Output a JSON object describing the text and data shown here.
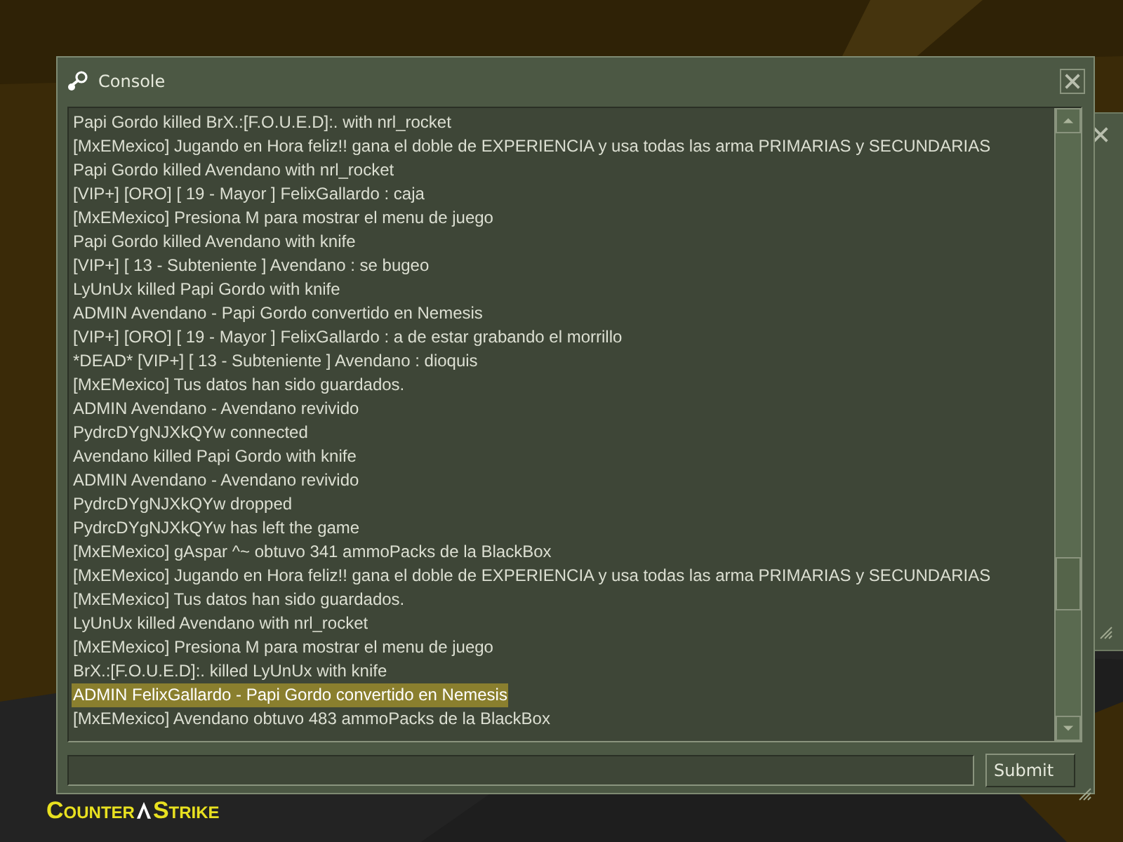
{
  "logo": {
    "left": "Counter",
    "right": "Strike"
  },
  "window": {
    "title": "Console"
  },
  "log": [
    {
      "text": "Papi Gordo killed BrX.:[F.O.U.E.D]:. with nrl_rocket",
      "selected": false
    },
    {
      "text": "[MxEMexico] Jugando en Hora feliz!! gana el doble de EXPERIENCIA y usa todas las arma PRIMARIAS y SECUNDARIAS",
      "selected": false
    },
    {
      "text": "Papi Gordo killed Avendano with nrl_rocket",
      "selected": false
    },
    {
      "text": "[VIP+] [ORO] [ 19 - Mayor ] FelixGallardo : caja",
      "selected": false
    },
    {
      "text": "[MxEMexico] Presiona M para mostrar el menu de juego",
      "selected": false
    },
    {
      "text": "Papi Gordo killed Avendano with knife",
      "selected": false
    },
    {
      "text": "[VIP+] [ 13 - Subteniente ] Avendano : se bugeo",
      "selected": false
    },
    {
      "text": "LyUnUx killed Papi Gordo with knife",
      "selected": false
    },
    {
      "text": "ADMIN Avendano - Papi Gordo convertido en Nemesis",
      "selected": false
    },
    {
      "text": "[VIP+] [ORO] [ 19 - Mayor ] FelixGallardo : a de estar grabando el morrillo",
      "selected": false
    },
    {
      "text": "*DEAD* [VIP+] [ 13 - Subteniente ] Avendano : dioquis",
      "selected": false
    },
    {
      "text": "[MxEMexico] Tus datos han sido guardados.",
      "selected": false
    },
    {
      "text": "ADMIN Avendano - Avendano revivido",
      "selected": false
    },
    {
      "text": "PydrcDYgNJXkQYw connected",
      "selected": false
    },
    {
      "text": "Avendano killed Papi Gordo with knife",
      "selected": false
    },
    {
      "text": "ADMIN Avendano - Avendano revivido",
      "selected": false
    },
    {
      "text": "PydrcDYgNJXkQYw dropped",
      "selected": false
    },
    {
      "text": "PydrcDYgNJXkQYw has left the game",
      "selected": false
    },
    {
      "text": "[MxEMexico] gAspar ^~ obtuvo 341 ammoPacks de la BlackBox",
      "selected": false
    },
    {
      "text": "[MxEMexico] Jugando en Hora feliz!! gana el doble de EXPERIENCIA y usa todas las arma PRIMARIAS y SECUNDARIAS",
      "selected": false
    },
    {
      "text": "[MxEMexico] Tus datos han sido guardados.",
      "selected": false
    },
    {
      "text": "LyUnUx killed Avendano with nrl_rocket",
      "selected": false
    },
    {
      "text": "[MxEMexico] Presiona M para mostrar el menu de juego",
      "selected": false
    },
    {
      "text": "BrX.:[F.O.U.E.D]:. killed LyUnUx with knife",
      "selected": false
    },
    {
      "text": "ADMIN FelixGallardo - Papi Gordo convertido en Nemesis",
      "selected": true
    },
    {
      "text": "[MxEMexico] Avendano obtuvo 483 ammoPacks de la BlackBox",
      "selected": false
    }
  ],
  "submit_button": "Submit"
}
